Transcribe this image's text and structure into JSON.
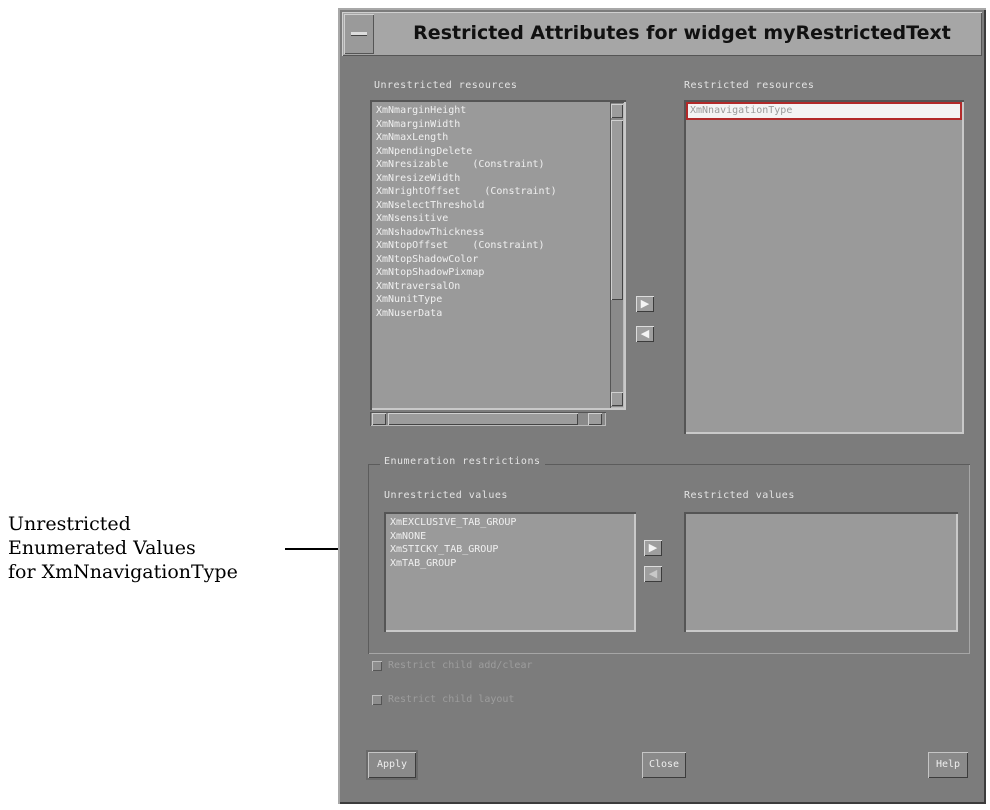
{
  "annotation": {
    "lines": [
      "Unrestricted",
      "Enumerated Values",
      "for XmNnavigationType"
    ]
  },
  "window": {
    "title": "Restricted Attributes for widget myRestrictedText"
  },
  "resources": {
    "unrestricted_label": "Unrestricted resources",
    "restricted_label": "Restricted resources",
    "unrestricted_items": [
      "XmNmarginHeight",
      "XmNmarginWidth",
      "XmNmaxLength",
      "XmNpendingDelete",
      "XmNresizable    (Constraint)",
      "XmNresizeWidth",
      "XmNrightOffset    (Constraint)",
      "XmNselectThreshold",
      "XmNsensitive",
      "XmNshadowThickness",
      "XmNtopOffset    (Constraint)",
      "XmNtopShadowColor",
      "XmNtopShadowPixmap",
      "XmNtraversalOn",
      "XmNunitType",
      "XmNuserData"
    ],
    "restricted_items": [
      "XmNnavigationType"
    ],
    "move_right_icon": "right-triangle",
    "move_left_icon": "left-triangle"
  },
  "enumeration": {
    "frame_label": "Enumeration restrictions",
    "unrestricted_label": "Unrestricted values",
    "restricted_label": "Restricted values",
    "unrestricted_items": [
      "XmEXCLUSIVE_TAB_GROUP",
      "XmNONE",
      "XmSTICKY_TAB_GROUP",
      "XmTAB_GROUP"
    ],
    "restricted_items": []
  },
  "options": {
    "restrict_child_add": "Restrict child add/clear",
    "restrict_child_layout": "Restrict child layout"
  },
  "buttons": {
    "apply": "Apply",
    "close": "Close",
    "help": "Help"
  },
  "colors": {
    "window_bg": "#7c7c7c",
    "selection_border": "#b22a2a"
  }
}
